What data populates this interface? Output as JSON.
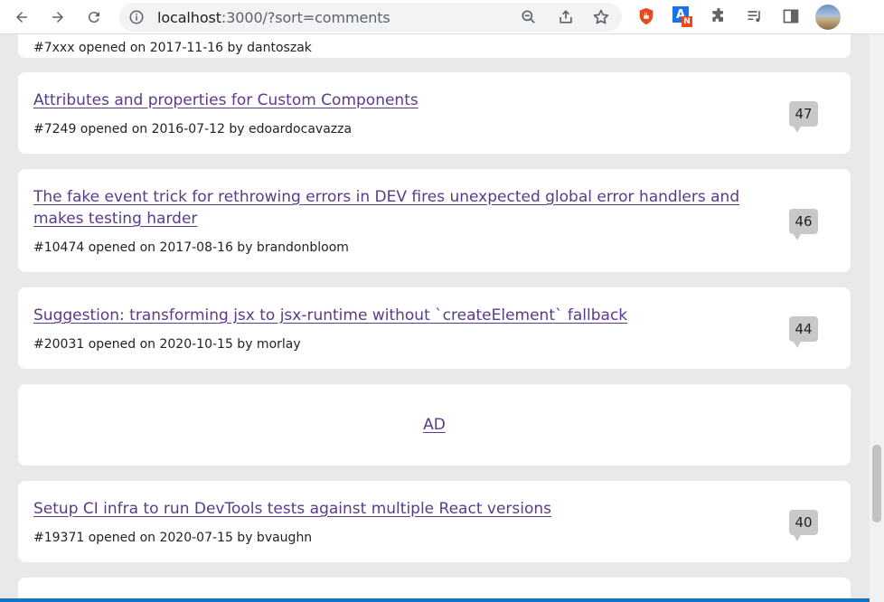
{
  "browser": {
    "url_host": "localhost",
    "url_rest": ":3000/?sort=comments",
    "icons": [
      "back-icon",
      "forward-icon",
      "reload-icon",
      "info-icon",
      "zoom-icon",
      "share-icon",
      "bookmark-star-icon",
      "extension-shield-icon",
      "extension-translate-icon",
      "extensions-puzzle-icon",
      "media-queue-icon",
      "side-panel-icon",
      "profile-avatar"
    ],
    "translate_badge": "N",
    "translate_letter": "A"
  },
  "partial_top": {
    "meta": "#7xxx opened on 2017-11-16 by dantoszak"
  },
  "issues": [
    {
      "title": "Attributes and properties for Custom Components",
      "meta": "#7249 opened on 2016-07-12 by edoardocavazza",
      "comments": "47"
    },
    {
      "title": "The fake event trick for rethrowing errors in DEV fires unexpected global error handlers and makes testing harder",
      "meta": "#10474 opened on 2017-08-16 by brandonbloom",
      "comments": "46"
    },
    {
      "title": "Suggestion: transforming jsx to jsx-runtime without `createElement` fallback",
      "meta": "#20031 opened on 2020-10-15 by morlay",
      "comments": "44"
    },
    {
      "title": "Setup CI infra to run DevTools tests against multiple React versions",
      "meta": "#19371 opened on 2020-07-15 by bvaughn",
      "comments": "40"
    }
  ],
  "ad": {
    "label": "AD"
  },
  "colors": {
    "link": "#5a3a8a",
    "page_bg": "#e9e9e9",
    "card_bg": "#ffffff",
    "badge_bg": "#c8c8c8"
  }
}
